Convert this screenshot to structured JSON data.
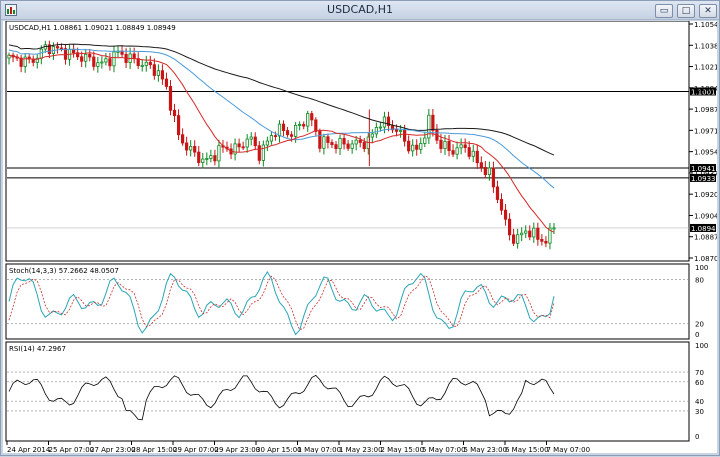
{
  "window": {
    "title": "USDCAD,H1",
    "buttons": {
      "minimize": "▭",
      "maximize": "□",
      "close": "✕"
    }
  },
  "main_chart": {
    "header": "USDCAD,H1  1.08861 1.09021 1.08849 1.08949",
    "price_labels": [
      "1.10545",
      "1.10380",
      "1.10210",
      "1.10045",
      "1.09875",
      "1.09710",
      "1.09540",
      "1.09375",
      "1.09205",
      "1.09040",
      "1.08870",
      "1.08705"
    ],
    "hlines": [
      {
        "price": 1.1001,
        "label": "1.10010"
      },
      {
        "price": 1.09415,
        "label": "1.09415"
      },
      {
        "price": 1.09338,
        "label": "1.09338"
      }
    ],
    "bid_label": "1.08949",
    "colors": {
      "up": "#0a8a1f",
      "down": "#c81414",
      "ma_fast": "#d62828",
      "ma_mid": "#4a9ad8",
      "ma_slow": "#1b1b1b"
    }
  },
  "stoch_panel": {
    "header": "Stoch(14,3,3) 57.2662 48.0507",
    "levels": [
      "100",
      "80",
      "20",
      "0"
    ],
    "k_last": 57.2662,
    "d_last": 48.0507
  },
  "rsi_panel": {
    "header": "RSI(14) 47.2967",
    "levels": [
      "100",
      "70",
      "60",
      "40",
      "30",
      "0"
    ],
    "last": 47.2967
  },
  "time_axis": [
    "24 Apr 2014",
    "25 Apr 07:00",
    "27 Apr 23:00",
    "28 Apr 15:00",
    "29 Apr 07:00",
    "29 Apr 23:00",
    "30 Apr 15:00",
    "1 May 07:00",
    "1 May 23:00",
    "2 May 15:00",
    "5 May 07:00",
    "5 May 23:00",
    "6 May 15:00",
    "7 May 07:00"
  ],
  "chart_data": [
    {
      "type": "candlestick",
      "title": "USDCAD,H1",
      "series": [
        {
          "name": "USDCAD",
          "ohlc_last": [
            1.08861,
            1.09021,
            1.08849,
            1.08949
          ]
        }
      ],
      "ylim": [
        1.087,
        1.1055
      ]
    },
    {
      "type": "line",
      "title": "Stoch(14,3,3) 57.2662 48.0507",
      "ylim": [
        0,
        100
      ],
      "levels": [
        20,
        80
      ]
    },
    {
      "type": "line",
      "title": "RSI(14) 47.2967",
      "ylim": [
        0,
        100
      ],
      "levels": [
        30,
        40,
        60,
        70
      ]
    }
  ]
}
